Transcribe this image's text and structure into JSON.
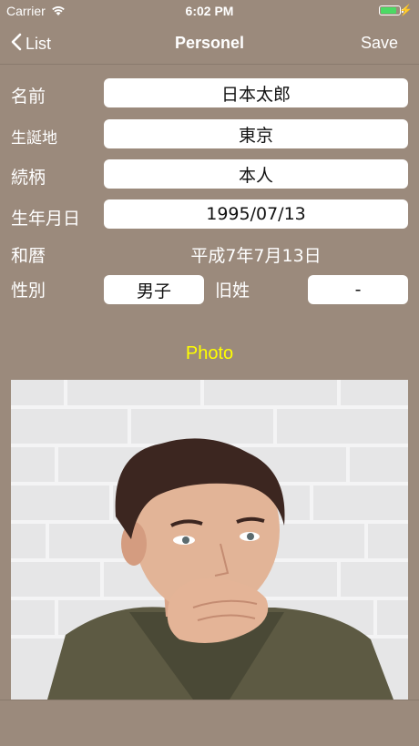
{
  "status_bar": {
    "carrier": "Carrier",
    "time": "6:02 PM"
  },
  "nav": {
    "back_label": "List",
    "title": "Personel",
    "save_label": "Save"
  },
  "form": {
    "name_label": "名前",
    "name_value": "日本太郎",
    "birthplace_label": "生誕地",
    "birthplace_value": "東京",
    "relation_label": "続柄",
    "relation_value": "本人",
    "birthdate_label": "生年月日",
    "birthdate_value": "1995/07/13",
    "wareki_label": "和暦",
    "wareki_value": "平成7年7月13日",
    "gender_label": "性別",
    "gender_value": "男子",
    "maiden_label": "旧姓",
    "maiden_value": "-"
  },
  "photo": {
    "label": "Photo"
  },
  "colors": {
    "background": "#9b8a7c",
    "photo_label": "#ffff00",
    "battery": "#4cd964"
  }
}
